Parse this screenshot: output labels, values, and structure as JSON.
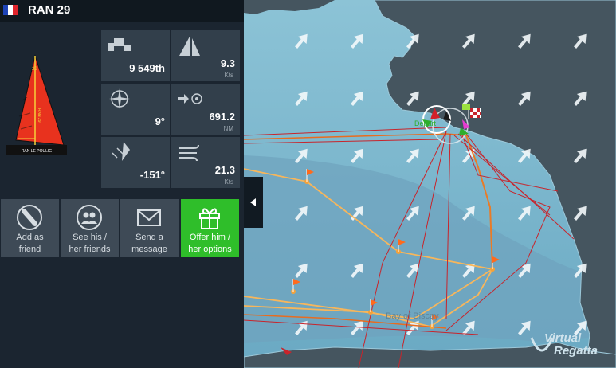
{
  "header": {
    "boat_name": "RAN 29",
    "flag": [
      "#1e44b8",
      "#ffffff",
      "#e0242c"
    ]
  },
  "boat": {
    "sail_number": "29",
    "sail_text": "RAN 29",
    "name_plate": "RAN LE POULIG",
    "sail_color": "#e8321e"
  },
  "stats": {
    "rank": {
      "value": "9 549th",
      "icon": "podium-icon"
    },
    "speed": {
      "value": "9.3",
      "unit": "Kts",
      "icon": "sail-speed-icon"
    },
    "heading": {
      "value": "9°",
      "icon": "compass-icon"
    },
    "distance": {
      "value": "691.2",
      "unit": "NM",
      "icon": "distance-target-icon"
    },
    "twa": {
      "value": "-151°",
      "icon": "wind-angle-icon"
    },
    "wind_speed": {
      "value": "21.3",
      "unit": "Kts",
      "icon": "wind-icon"
    }
  },
  "actions": [
    {
      "label_1": "Add as",
      "label_2": "friend",
      "icon": "add-friend-icon"
    },
    {
      "label_1": "See his /",
      "label_2": "her friends",
      "icon": "friends-icon"
    },
    {
      "label_1": "Send a",
      "label_2": "message",
      "icon": "envelope-icon"
    },
    {
      "label_1": "Offer him /",
      "label_2": "her options",
      "icon": "gift-icon"
    }
  ],
  "map": {
    "sea_label": "Bay of Biscay",
    "logo_line1": "Virtual",
    "logo_line2": "Regatta",
    "colors": {
      "sea": "#79b6cd",
      "land": "#45555f",
      "route": "#f7b65b",
      "track": "#c8242b"
    }
  }
}
